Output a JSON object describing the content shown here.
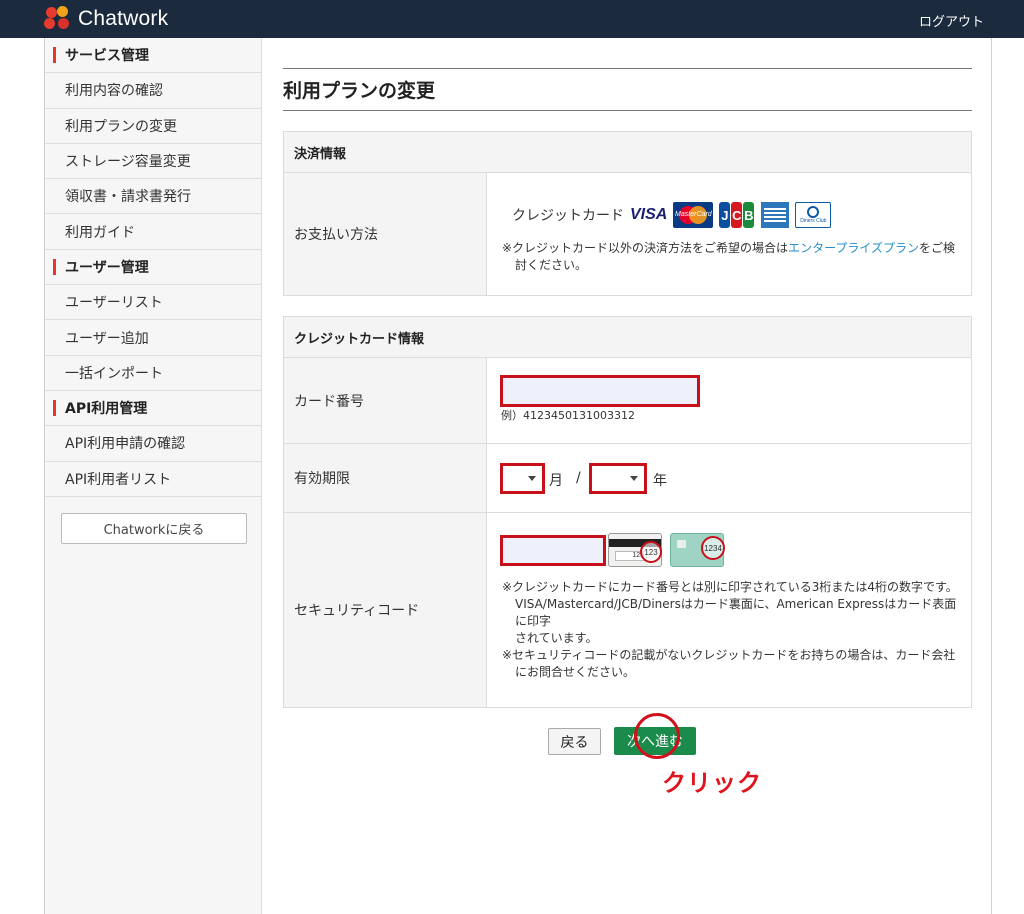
{
  "header": {
    "app_name": "Chatwork",
    "logout": "ログアウト"
  },
  "sidebar": {
    "rows": [
      {
        "label": "サービス管理",
        "head": true
      },
      {
        "label": "利用内容の確認"
      },
      {
        "label": "利用プランの変更"
      },
      {
        "label": "ストレージ容量変更"
      },
      {
        "label": "領収書・請求書発行"
      },
      {
        "label": "利用ガイド"
      },
      {
        "label": "ユーザー管理",
        "head": true
      },
      {
        "label": "ユーザーリスト"
      },
      {
        "label": "ユーザー追加"
      },
      {
        "label": "一括インポート"
      },
      {
        "label": "API利用管理",
        "head": true
      },
      {
        "label": "API利用申請の確認"
      },
      {
        "label": "API利用者リスト"
      }
    ],
    "back_button": "Chatworkに戻る"
  },
  "main": {
    "page_title": "利用プランの変更",
    "payment": {
      "heading": "決済情報",
      "label": "お支払い方法",
      "method": "クレジットカード",
      "note_prefix": "※クレジットカード以外の決済方法をご希望の場合は",
      "note_link": "エンタープライズプラン",
      "note_suffix_1": "をご検",
      "note_suffix_2": "討ください。",
      "brands": {
        "visa": "VISA",
        "mastercard": "MasterCard",
        "diners": "Diners Club"
      }
    },
    "card": {
      "heading": "クレジットカード情報",
      "number_label": "カード番号",
      "number_value": "",
      "number_example": "例）4123450131003312",
      "expiry_label": "有効期限",
      "month_unit": "月",
      "separator": "/",
      "year_unit": "年",
      "security_label": "セキュリティコード",
      "security_value": "",
      "back_sample": "123",
      "front_sample": "1234",
      "note_lines": [
        "※クレジットカードにカード番号とは別に印字されている3桁または4桁の数字です。",
        "VISA/Mastercard/JCB/Dinersはカード裏面に、American Expressはカード表面に印字",
        "されています。",
        "※セキュリティコードの記載がないクレジットカードをお持ちの場合は、カード会社",
        "にお問合せください。"
      ]
    },
    "buttons": {
      "back": "戻る",
      "next": "次へ進む"
    },
    "annotation": "クリック"
  },
  "colors": {
    "header_bg": "#1b2a3c",
    "accent_red": "#e5372a",
    "next_green": "#1a8b4b",
    "link": "#2a8fc7"
  }
}
